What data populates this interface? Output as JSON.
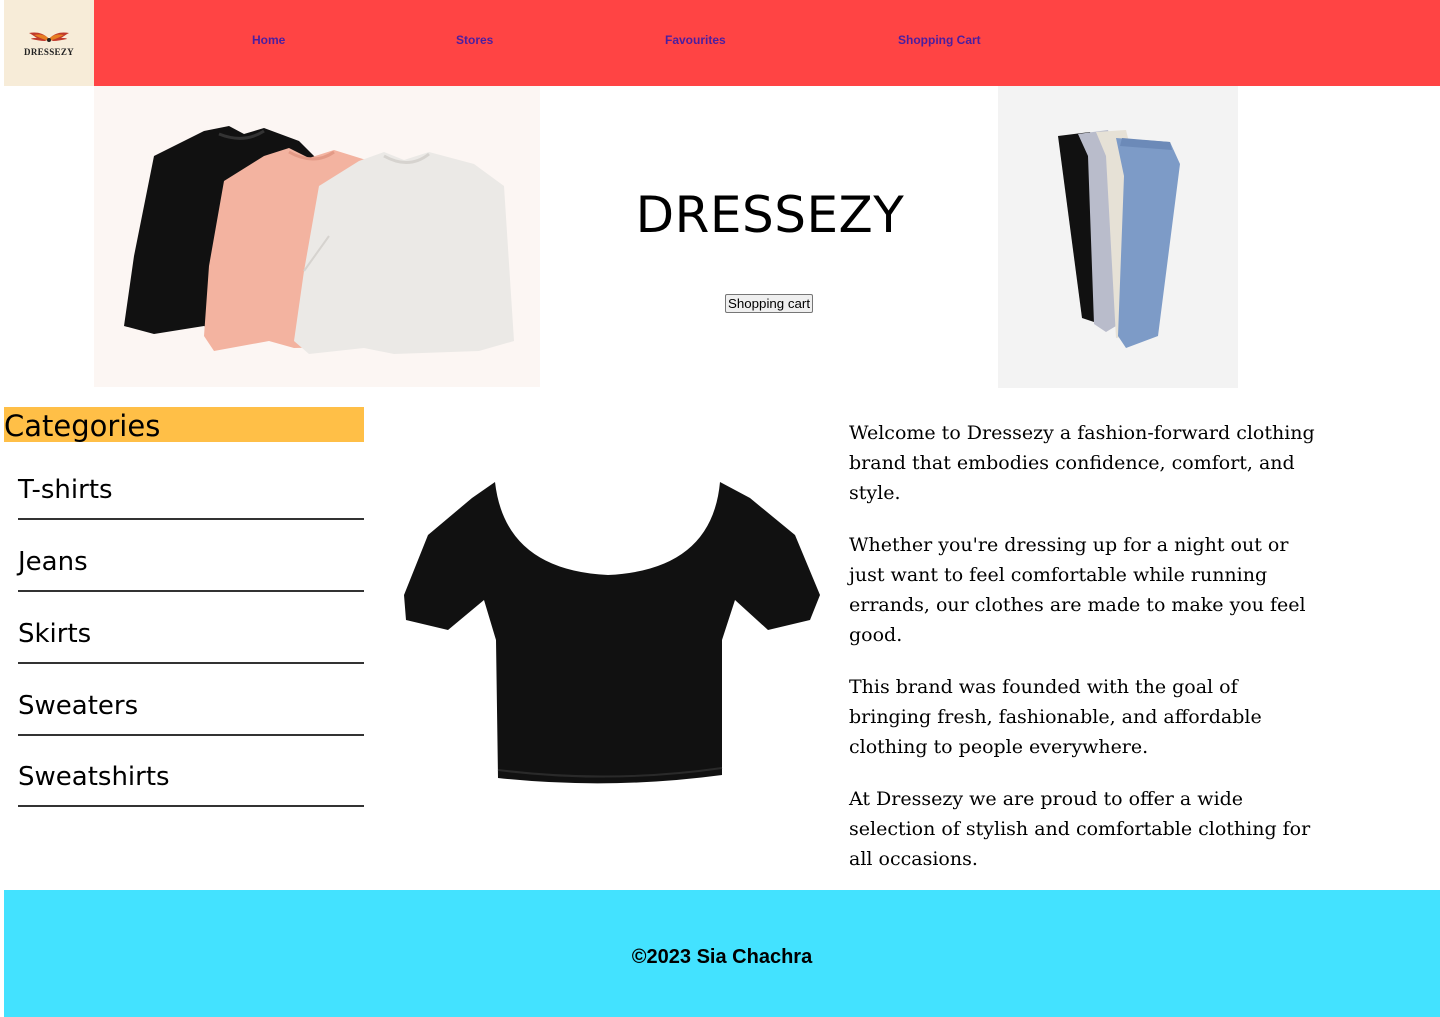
{
  "header": {
    "logo_text": "DRESSEZY",
    "nav": [
      {
        "label": "Home"
      },
      {
        "label": "Stores"
      },
      {
        "label": "Favourites"
      },
      {
        "label": "Shopping Cart"
      }
    ],
    "colors": {
      "navbar": "#ff4444",
      "nav_text": "#4b1fa0",
      "logo_bg": "#f7ecd8"
    }
  },
  "hero": {
    "title": "DRESSEZY",
    "cart_button": "Shopping cart",
    "left_image": "sweaters-image",
    "right_image": "joggers-image"
  },
  "categories": {
    "title": "Categories",
    "items": [
      {
        "label": "T-shirts"
      },
      {
        "label": "Jeans"
      },
      {
        "label": "Skirts"
      },
      {
        "label": "Sweaters"
      },
      {
        "label": "Sweatshirts"
      }
    ],
    "title_bg": "#ffbf47"
  },
  "product": {
    "image": "black-crop-top-image"
  },
  "about": {
    "paragraphs": [
      "Welcome to Dressezy a fashion-forward clothing brand that embodies confidence, comfort, and style.",
      "Whether you're dressing up for a night out or just want to feel comfortable while running errands, our clothes are made to make you feel good.",
      "This brand was founded with the goal of bringing fresh, fashionable, and affordable clothing to people everywhere.",
      "At Dressezy we are proud to offer a wide selection of stylish and comfortable clothing for all occasions."
    ]
  },
  "footer": {
    "copyright": "©2023 Sia Chachra",
    "bg": "#43e2ff"
  }
}
